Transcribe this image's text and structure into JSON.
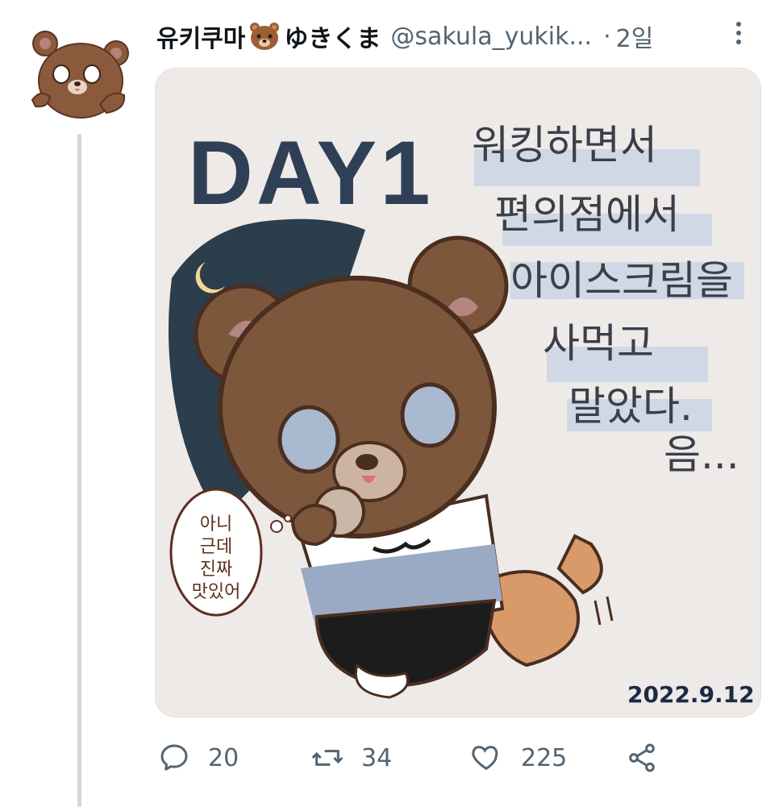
{
  "tweet": {
    "display_name": "유키쿠마",
    "display_name_suffix": "ゆきくま",
    "handle": "@sakula_yukik...",
    "separator": "·",
    "time": "2일",
    "media": {
      "title_text": "DAY1",
      "korean_lines": [
        "워킹하면서",
        "편의점에서",
        "아이스크림을",
        "사먹고",
        "말았다.",
        "음..."
      ],
      "speech_bubble_lines": [
        "아니",
        "근데",
        "진짜",
        "맛있어"
      ],
      "date_text": "2022.9.12"
    },
    "actions": {
      "reply_count": "20",
      "retweet_count": "34",
      "like_count": "225"
    }
  },
  "icons": [
    "reply-icon",
    "retweet-icon",
    "like-icon",
    "share-icon",
    "more-icon",
    "avatar-bear",
    "bear-emoji-icon"
  ],
  "colors": {
    "accent_text": "#536471",
    "thread_line": "#cfd9de",
    "bear_brown": "#7a5235"
  }
}
